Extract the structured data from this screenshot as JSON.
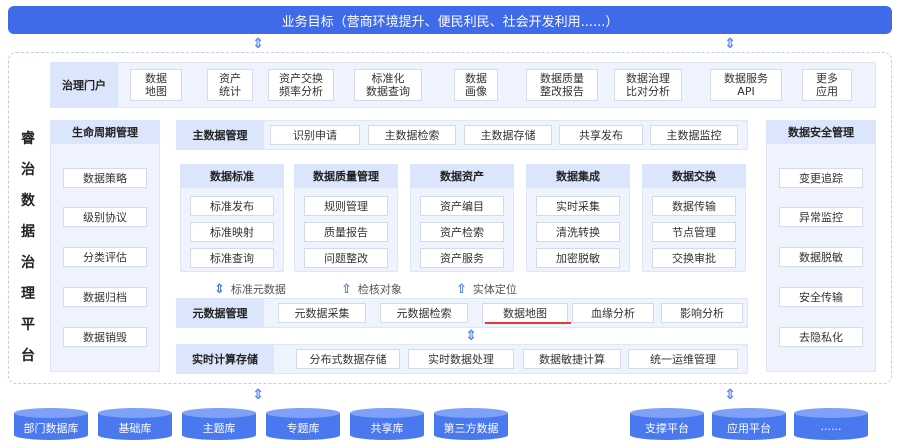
{
  "banner": "业务目标（营商环境提升、便民利民、社会开发利用......）",
  "side_title": [
    "睿",
    "治",
    "数",
    "据",
    "治",
    "理",
    "平",
    "台"
  ],
  "portal": {
    "label": "治理门户",
    "items": [
      [
        "数据",
        "地图"
      ],
      [
        "资产",
        "统计"
      ],
      [
        "资产交换",
        "频率分析"
      ],
      [
        "标准化",
        "数据查询"
      ],
      [
        "数据",
        "画像"
      ],
      [
        "数据质量",
        "整改报告"
      ],
      [
        "数据治理",
        "比对分析"
      ],
      [
        "数据服务",
        "API"
      ],
      [
        "更多",
        "应用"
      ]
    ]
  },
  "lifecycle": {
    "title": "生命周期管理",
    "items": [
      "数据策略",
      "级别协议",
      "分类评估",
      "数据归档",
      "数据销毁"
    ]
  },
  "security": {
    "title": "数据安全管理",
    "items": [
      "变更追踪",
      "异常监控",
      "数据脱敏",
      "安全传输",
      "去隐私化"
    ]
  },
  "master": {
    "title": "主数据管理",
    "items": [
      "识别申请",
      "主数据检索",
      "主数据存储",
      "共享发布",
      "主数据监控"
    ]
  },
  "modules": [
    {
      "title": "数据标准",
      "items": [
        "标准发布",
        "标准映射",
        "标准查询"
      ]
    },
    {
      "title": "数据质量管理",
      "items": [
        "规则管理",
        "质量报告",
        "问题整改"
      ]
    },
    {
      "title": "数据资产",
      "items": [
        "资产编目",
        "资产检索",
        "资产服务"
      ]
    },
    {
      "title": "数据集成",
      "items": [
        "实时采集",
        "清洗转换",
        "加密脱敏"
      ]
    },
    {
      "title": "数据交换",
      "items": [
        "数据传输",
        "节点管理",
        "交换审批"
      ]
    }
  ],
  "flows": [
    "标准元数据",
    "检核对象",
    "实体定位"
  ],
  "metadata": {
    "title": "元数据管理",
    "items": [
      "元数据采集",
      "元数据检索",
      "数据地图",
      "血缘分析",
      "影响分析"
    ]
  },
  "realtime": {
    "title": "实时计算存储",
    "items": [
      "分布式数据存储",
      "实时数据处理",
      "数据敏捷计算",
      "统一运维管理"
    ]
  },
  "databases_left": [
    "部门数据库",
    "基础库",
    "主题库",
    "专题库",
    "共享库",
    "第三方数据"
  ],
  "databases_right": [
    "支撑平台",
    "应用平台",
    "......"
  ],
  "colors": {
    "primary": "#3f6bea",
    "panel": "#eef3fd",
    "header": "#dbe5fb",
    "highlight": "#e53935"
  }
}
